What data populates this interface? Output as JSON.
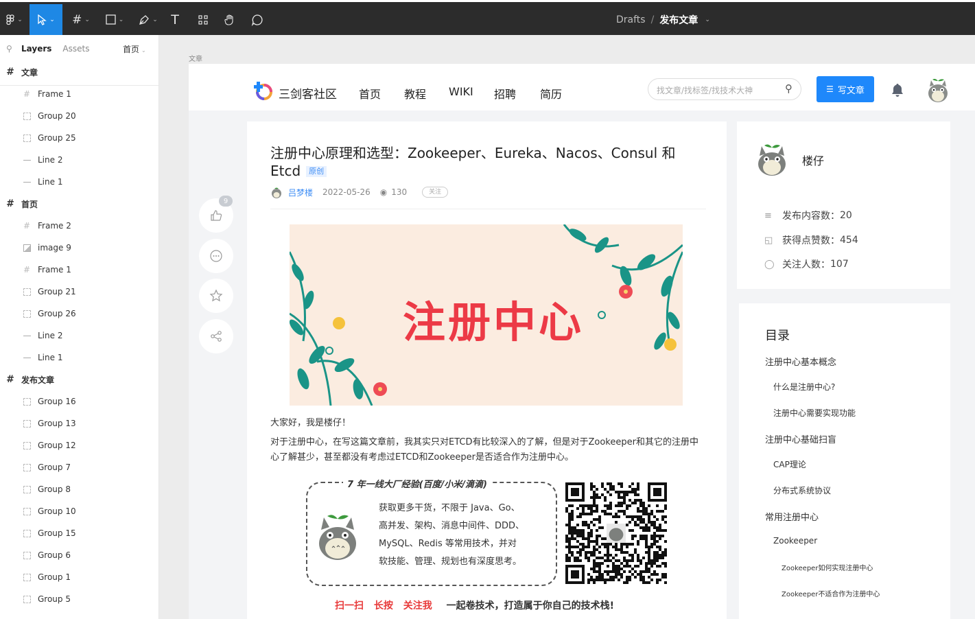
{
  "toolbar": {
    "breadcrumb": {
      "parent": "Drafts",
      "separator": "/",
      "current": "发布文章"
    },
    "accent_color": "#1e88e5"
  },
  "left_panel": {
    "tabs": {
      "layers": "Layers",
      "assets": "Assets",
      "page": "首页"
    },
    "layers": [
      {
        "label": "文章",
        "type": "top"
      },
      {
        "label": "Frame 1",
        "type": "frame"
      },
      {
        "label": "Group 20",
        "type": "group"
      },
      {
        "label": "Group 25",
        "type": "group"
      },
      {
        "label": "Line 2",
        "type": "line"
      },
      {
        "label": "Line 1",
        "type": "line"
      },
      {
        "label": "首页",
        "type": "top"
      },
      {
        "label": "Frame 2",
        "type": "frame"
      },
      {
        "label": "image 9",
        "type": "image"
      },
      {
        "label": "Frame 1",
        "type": "frame"
      },
      {
        "label": "Group 21",
        "type": "group"
      },
      {
        "label": "Group 26",
        "type": "group"
      },
      {
        "label": "Line 2",
        "type": "line"
      },
      {
        "label": "Line 1",
        "type": "line"
      },
      {
        "label": "发布文章",
        "type": "top"
      },
      {
        "label": "Group 16",
        "type": "group"
      },
      {
        "label": "Group 13",
        "type": "group"
      },
      {
        "label": "Group 12",
        "type": "group"
      },
      {
        "label": "Group 7",
        "type": "group"
      },
      {
        "label": "Group 8",
        "type": "group"
      },
      {
        "label": "Group 10",
        "type": "group"
      },
      {
        "label": "Group 15",
        "type": "group"
      },
      {
        "label": "Group 6",
        "type": "group"
      },
      {
        "label": "Group 1",
        "type": "group"
      },
      {
        "label": "Group 5",
        "type": "group"
      }
    ]
  },
  "canvas": {
    "frame_label": "文章",
    "site": {
      "name": "三剑客社区",
      "nav": [
        "首页",
        "教程",
        "WIKI",
        "招聘",
        "简历"
      ],
      "search_placeholder": "找文章/找标签/找技术大神",
      "write_button": "写文章",
      "brand_color": "#1e88fb"
    },
    "article": {
      "title": "注册中心原理和选型：Zookeeper、Eureka、Nacos、Consul 和 Etcd",
      "tag": "原创",
      "author": "吕梦楼",
      "date": "2022-05-26",
      "views": "130",
      "follow": "关注",
      "like_count": "9",
      "banner_text": "注册中心",
      "intro": "大家好，我是楼仔！",
      "para": "对于注册中心，在写这篇文章前，我其实只对ETCD有比较深入的了解，但是对于Zookeeper和其它的注册中心了解甚少，甚至都没有考虑过ETCD和Zookeeper是否适合作为注册中心。",
      "promo_title": "7 年一线大厂经验(百度/小米/滴滴)",
      "promo_lines": [
        "获取更多干货，不限于 Java、Go、",
        "高并发、架构、消息中间件、DDD、",
        "MySQL、Redis 等常用技术，并对",
        "软技能、管理、规划也有深度思考。"
      ],
      "cta": {
        "scan": "扫一扫",
        "press": "长按",
        "follow": "关注我",
        "slogan": "一起卷技术，打造属于你自己的技术栈!"
      }
    },
    "profile": {
      "name": "楼仔",
      "stats": [
        {
          "label": "发布内容数：",
          "value": "20",
          "icon": "layers-icon"
        },
        {
          "label": "获得点赞数：",
          "value": "454",
          "icon": "thumbs-up-icon"
        },
        {
          "label": "关注人数：",
          "value": "107",
          "icon": "user-icon"
        }
      ]
    },
    "toc": {
      "title": "目录",
      "items": [
        {
          "text": "注册中心基本概念",
          "level": 1
        },
        {
          "text": "什么是注册中心?",
          "level": 2
        },
        {
          "text": "注册中心需要实现功能",
          "level": 2
        },
        {
          "text": "注册中心基础扫盲",
          "level": 1
        },
        {
          "text": "CAP理论",
          "level": 2
        },
        {
          "text": "分布式系统协议",
          "level": 2
        },
        {
          "text": "常用注册中心",
          "level": 1
        },
        {
          "text": "Zookeeper",
          "level": 2
        },
        {
          "text": "Zookeeper如何实现注册中心",
          "level": 3
        },
        {
          "text": "Zookeeper不适合作为注册中心",
          "level": 3
        }
      ]
    }
  }
}
